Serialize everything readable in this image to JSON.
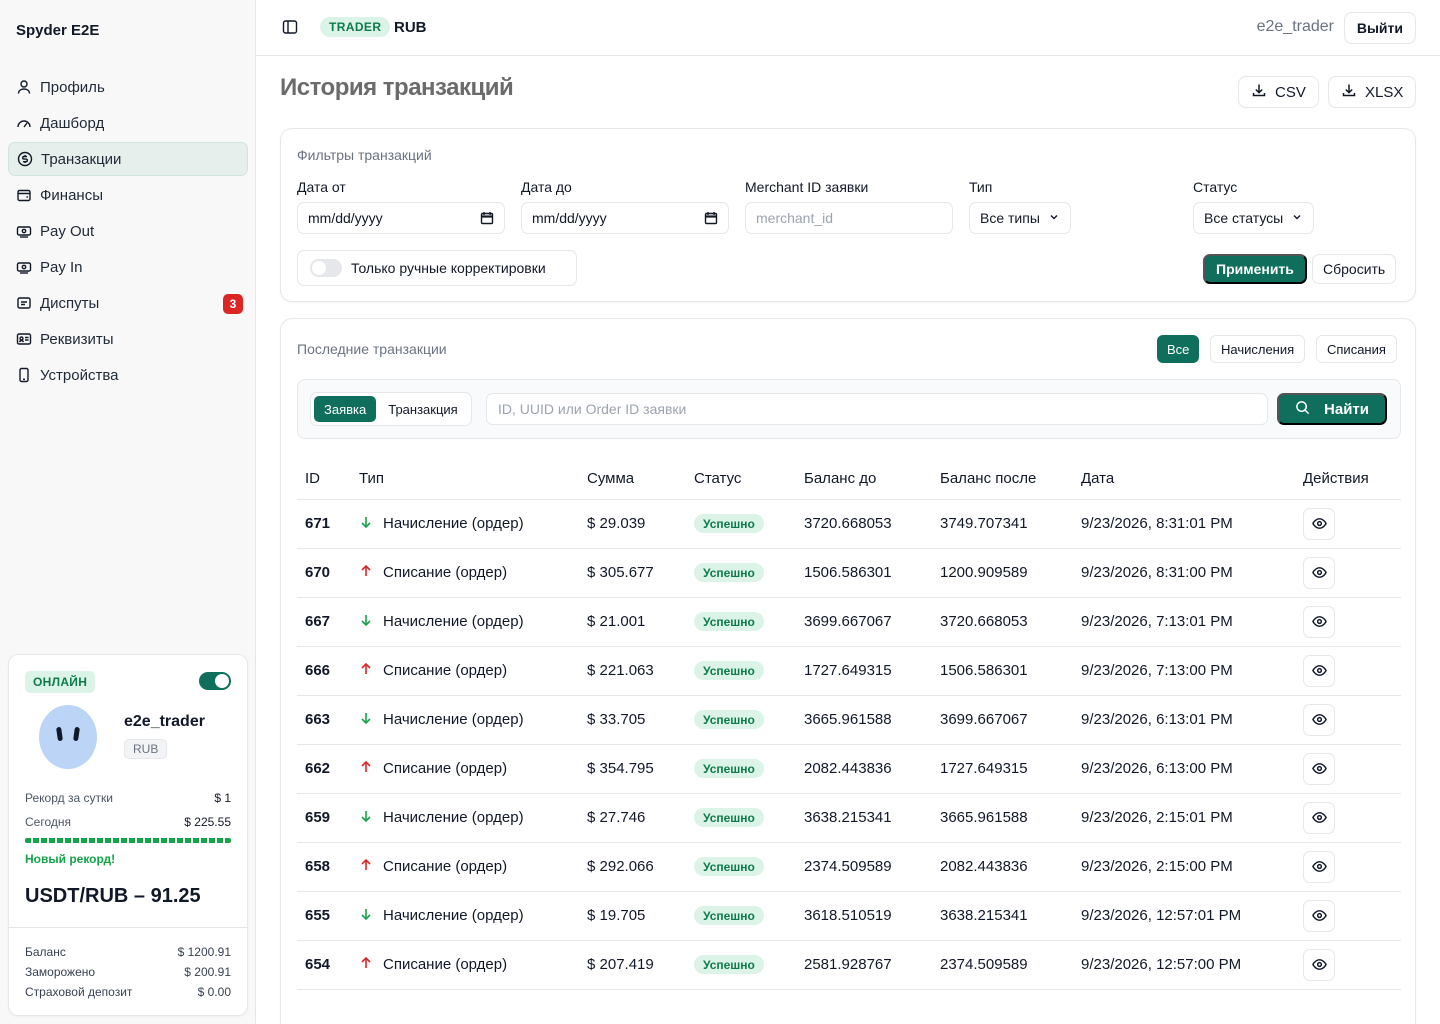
{
  "app": {
    "brand": "Spyder E2E"
  },
  "sidebar": {
    "items": [
      {
        "label": "Профиль",
        "icon": "user-icon"
      },
      {
        "label": "Дашборд",
        "icon": "gauge-icon"
      },
      {
        "label": "Транзакции",
        "icon": "dollar-circle-icon",
        "active": true
      },
      {
        "label": "Финансы",
        "icon": "wallet-icon"
      },
      {
        "label": "Pay Out",
        "icon": "payout-icon"
      },
      {
        "label": "Pay In",
        "icon": "payin-icon"
      },
      {
        "label": "Диспуты",
        "icon": "alert-icon",
        "badge": "3"
      },
      {
        "label": "Реквизиты",
        "icon": "id-card-icon"
      },
      {
        "label": "Устройства",
        "icon": "phone-icon"
      }
    ]
  },
  "trader_card": {
    "status": "ОНЛАЙН",
    "online": true,
    "name": "e2e_trader",
    "currency": "RUB",
    "record_label": "Рекорд за сутки",
    "record_value": "$ 1",
    "today_label": "Сегодня",
    "today_value": "$ 225.55",
    "record_note": "Новый рекорд!",
    "rate": "USDT/RUB – 91.25",
    "balance_label": "Баланс",
    "balance_value": "$ 1200.91",
    "frozen_label": "Заморожено",
    "frozen_value": "$ 200.91",
    "deposit_label": "Страховой депозит",
    "deposit_value": "$ 0.00"
  },
  "topbar": {
    "role": "TRADER",
    "currency": "RUB",
    "username": "e2e_trader",
    "logout": "Выйти"
  },
  "page": {
    "title": "История транзакций",
    "export_csv": "CSV",
    "export_xlsx": "XLSX"
  },
  "filters": {
    "title": "Фильтры транзакций",
    "date_from_label": "Дата от",
    "date_from_value": "mm/dd/yyyy",
    "date_to_label": "Дата до",
    "date_to_value": "mm/dd/yyyy",
    "merchant_label": "Merchant ID заявки",
    "merchant_placeholder": "merchant_id",
    "type_label": "Тип",
    "type_value": "Все типы",
    "status_label": "Статус",
    "status_value": "Все статусы",
    "manual_only": "Только ручные корректировки",
    "apply": "Применить",
    "reset": "Сбросить"
  },
  "transactions": {
    "title": "Последние транзакции",
    "tab_all": "Все",
    "tab_credits": "Начисления",
    "tab_debits": "Списания",
    "mode_order": "Заявка",
    "mode_tx": "Транзакция",
    "search_placeholder": "ID, UUID или Order ID заявки",
    "search_button": "Найти",
    "columns": [
      "ID",
      "Тип",
      "Сумма",
      "Статус",
      "Баланс до",
      "Баланс после",
      "Дата",
      "Действия"
    ],
    "rows": [
      {
        "id": "671",
        "dir": "in",
        "type": "Начисление (ордер)",
        "amount": "$ 29.039",
        "status": "Успешно",
        "before": "3720.668053",
        "after": "3749.707341",
        "date": "9/23/2026, 8:31:01 PM"
      },
      {
        "id": "670",
        "dir": "out",
        "type": "Списание (ордер)",
        "amount": "$ 305.677",
        "status": "Успешно",
        "before": "1506.586301",
        "after": "1200.909589",
        "date": "9/23/2026, 8:31:00 PM"
      },
      {
        "id": "667",
        "dir": "in",
        "type": "Начисление (ордер)",
        "amount": "$ 21.001",
        "status": "Успешно",
        "before": "3699.667067",
        "after": "3720.668053",
        "date": "9/23/2026, 7:13:01 PM"
      },
      {
        "id": "666",
        "dir": "out",
        "type": "Списание (ордер)",
        "amount": "$ 221.063",
        "status": "Успешно",
        "before": "1727.649315",
        "after": "1506.586301",
        "date": "9/23/2026, 7:13:00 PM"
      },
      {
        "id": "663",
        "dir": "in",
        "type": "Начисление (ордер)",
        "amount": "$ 33.705",
        "status": "Успешно",
        "before": "3665.961588",
        "after": "3699.667067",
        "date": "9/23/2026, 6:13:01 PM"
      },
      {
        "id": "662",
        "dir": "out",
        "type": "Списание (ордер)",
        "amount": "$ 354.795",
        "status": "Успешно",
        "before": "2082.443836",
        "after": "1727.649315",
        "date": "9/23/2026, 6:13:00 PM"
      },
      {
        "id": "659",
        "dir": "in",
        "type": "Начисление (ордер)",
        "amount": "$ 27.746",
        "status": "Успешно",
        "before": "3638.215341",
        "after": "3665.961588",
        "date": "9/23/2026, 2:15:01 PM"
      },
      {
        "id": "658",
        "dir": "out",
        "type": "Списание (ордер)",
        "amount": "$ 292.066",
        "status": "Успешно",
        "before": "2374.509589",
        "after": "2082.443836",
        "date": "9/23/2026, 2:15:00 PM"
      },
      {
        "id": "655",
        "dir": "in",
        "type": "Начисление (ордер)",
        "amount": "$ 19.705",
        "status": "Успешно",
        "before": "3618.510519",
        "after": "3638.215341",
        "date": "9/23/2026, 12:57:01 PM"
      },
      {
        "id": "654",
        "dir": "out",
        "type": "Списание (ордер)",
        "amount": "$ 207.419",
        "status": "Успешно",
        "before": "2581.928767",
        "after": "2374.509589",
        "date": "9/23/2026, 12:57:00 PM"
      }
    ]
  },
  "colors": {
    "accent": "#0f6f5c",
    "success_bg": "#dcf4e7",
    "success_text": "#0f7a4a",
    "danger": "#dc2626",
    "credit_arrow": "#16a34a",
    "debit_arrow": "#dc2626"
  }
}
